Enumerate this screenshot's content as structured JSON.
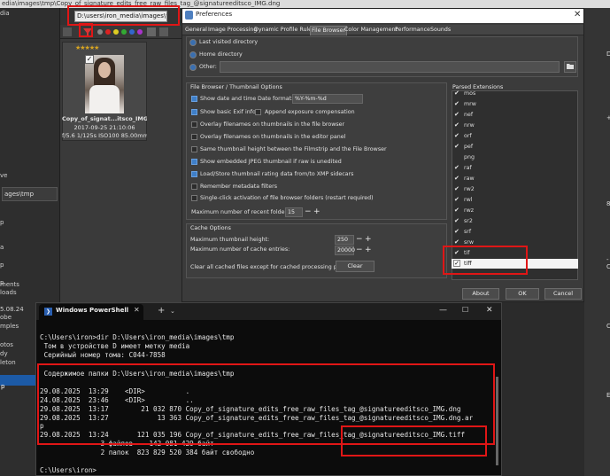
{
  "background_app": {
    "title": "edia\\images\\tmp\\Copy_of_signature_edits_free_raw_files_tag_@signatureeditsco_IMG.dng",
    "path_field": "D:\\users\\iron_media\\images\\tmp",
    "left_combo": "ages\\tmp",
    "left_items": [
      "dia",
      "ve",
      "p",
      "a",
      "p",
      "p",
      "ments",
      "loads",
      "5.08.24",
      "obe",
      "mples",
      "otos",
      "dy",
      "leton",
      "p"
    ],
    "thumbnail": {
      "stars": "★★★★★",
      "filename": "Copy_of_signat...itsco_IMG.dng",
      "date": "2017-09-25 21:10:06",
      "exif": "f/5.6 1/125s ISO100 85.00mm"
    },
    "right_items": [
      "DN",
      "+",
      "Ca",
      "EF",
      "8",
      "-C"
    ]
  },
  "preferences": {
    "title": "Preferences",
    "tabs": [
      "General",
      "Image Processing",
      "Dynamic Profile Rules",
      "File Browser",
      "Color Management",
      "Performance",
      "Sounds"
    ],
    "active_tab": "File Browser",
    "startup": {
      "last_visited": "Last visited directory",
      "home": "Home directory",
      "other": "Other:"
    },
    "fb_options": {
      "title": "File Browser / Thumbnail Options",
      "show_date_time": "Show date and time",
      "date_format_label": "Date format:",
      "date_format_value": "%Y-%m-%d",
      "show_exif": "Show basic Exif info",
      "append_exposure": "Append exposure compensation",
      "overlay_fb": "Overlay filenames on thumbnails in the file browser",
      "overlay_editor": "Overlay filenames on thumbnails in the editor panel",
      "same_height": "Same thumbnail height between the Filmstrip and the File Browser",
      "show_embedded": "Show embedded JPEG thumbnail if raw is unedited",
      "load_store": "Load/Store thumbnail rating data from/to XMP sidecars",
      "remember_filters": "Remember metadata filters",
      "single_click": "Single-click activation of file browser folders (restart required)",
      "max_recent_label": "Maximum number of recent folders:",
      "max_recent_value": "15"
    },
    "cache": {
      "title": "Cache Options",
      "max_height_label": "Maximum thumbnail height:",
      "max_height_value": "250",
      "max_entries_label": "Maximum number of cache entries:",
      "max_entries_value": "20000",
      "clear_label": "Clear all cached files except for cached processing profiles:",
      "clear_button": "Clear"
    },
    "parsed_extensions": {
      "title": "Parsed Extensions",
      "items": [
        {
          "name": "mos",
          "checked": true
        },
        {
          "name": "mrw",
          "checked": true
        },
        {
          "name": "nef",
          "checked": true
        },
        {
          "name": "nrw",
          "checked": true
        },
        {
          "name": "orf",
          "checked": true
        },
        {
          "name": "pef",
          "checked": true
        },
        {
          "name": "png",
          "checked": false
        },
        {
          "name": "raf",
          "checked": true
        },
        {
          "name": "raw",
          "checked": true
        },
        {
          "name": "rw2",
          "checked": true
        },
        {
          "name": "rwl",
          "checked": true
        },
        {
          "name": "rwz",
          "checked": true
        },
        {
          "name": "sr2",
          "checked": true
        },
        {
          "name": "srf",
          "checked": true
        },
        {
          "name": "srw",
          "checked": true
        },
        {
          "name": "tif",
          "checked": true
        },
        {
          "name": "tiff",
          "checked": true
        }
      ]
    },
    "buttons": {
      "about": "About",
      "ok": "OK",
      "cancel": "Cancel"
    }
  },
  "powershell": {
    "tab_title": "Windows PowerShell",
    "lines": [
      "C:\\Users\\iron>dir D:\\Users\\iron_media\\images\\tmp",
      " Том в устройстве D имеет метку media",
      " Серийный номер тома: C044-7858",
      "",
      " Содержимое папки D:\\Users\\iron_media\\images\\tmp",
      "",
      "29.08.2025  13:29    <DIR>          .",
      "24.08.2025  23:46    <DIR>          ..",
      "29.08.2025  13:17        21 032 870 Copy_of_signature_edits_free_raw_files_tag_@signatureeditsco_IMG.dng",
      "29.08.2025  13:27            13 363 Copy_of_signature_edits_free_raw_files_tag_@signatureeditsco_IMG.dng.ar",
      "p",
      "29.08.2025  13:24       121 035 196 Copy_of_signature_edits_free_raw_files_tag_@signatureeditsco_IMG.tiff",
      "               3 файлов    142 081 429 байт",
      "               2 папок  823 829 520 384 байт свободно",
      "",
      "C:\\Users\\iron>"
    ]
  }
}
